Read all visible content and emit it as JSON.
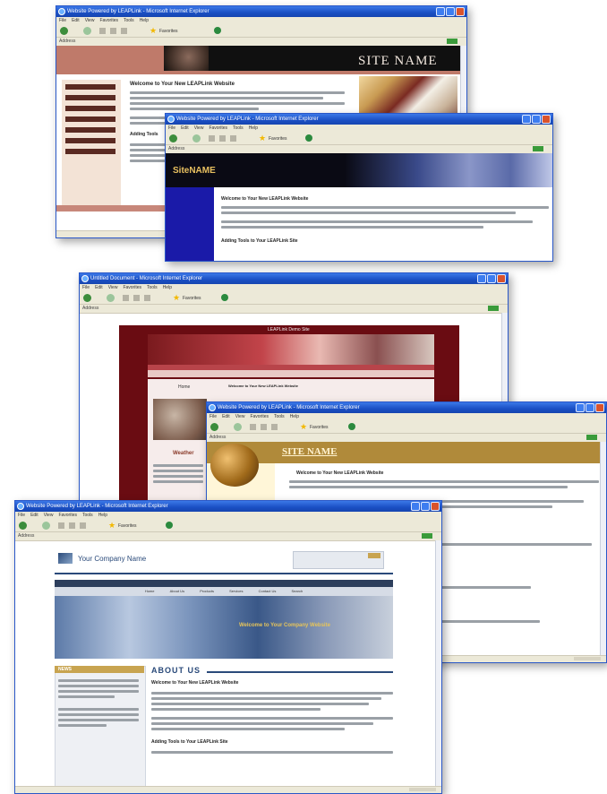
{
  "menu": [
    "File",
    "Edit",
    "View",
    "Favorites",
    "Tools",
    "Help"
  ],
  "toolbar": {
    "back": "Back",
    "favorites": "Favorites"
  },
  "address_label": "Address",
  "windows": {
    "w1": {
      "title": "Website Powered by LEAPLink - Microsoft Internet Explorer",
      "site_name": "SITE NAME",
      "welcome": "Welcome to Your New LEAPLink Website",
      "adding": "Adding Tools"
    },
    "w2": {
      "title": "Website Powered by LEAPLink - Microsoft Internet Explorer",
      "site_name": "SiteNAME",
      "welcome": "Welcome to Your New LEAPLink Website",
      "adding": "Adding Tools to Your LEAPLink Site"
    },
    "w3": {
      "title": "Untitled Document - Microsoft Internet Explorer",
      "site_title": "LEAPLink Demo Site",
      "nav_left": "Home",
      "heading": "Welcome to Your New LEAPLink Website",
      "side_text": "Weather"
    },
    "w4": {
      "title": "Website Powered by LEAPLink - Microsoft Internet Explorer",
      "site_name": "SITE NAME",
      "welcome": "Welcome to Your New LEAPLink Website"
    },
    "w5": {
      "title": "Website Powered by LEAPLink - Microsoft Internet Explorer",
      "company": "Your Company Name",
      "nav": [
        "Home",
        "About Us",
        "Products",
        "Services",
        "Contact Us",
        "Search"
      ],
      "banner": "Welcome to Your Company Website",
      "news_label": "NEWS",
      "about": "ABOUT US",
      "welcome": "Welcome to Your New LEAPLink Website",
      "adding": "Adding Tools to Your LEAPLink Site"
    }
  }
}
